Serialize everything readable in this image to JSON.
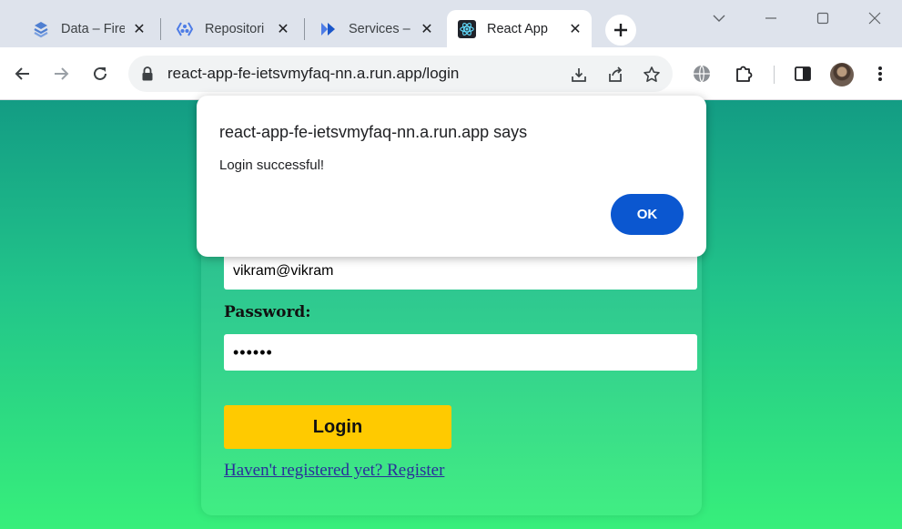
{
  "browser": {
    "tabs": [
      {
        "title": "Data – Fire",
        "icon": "firebase-icon",
        "active": false
      },
      {
        "title": "Repositori",
        "icon": "artifact-registry-icon",
        "active": false
      },
      {
        "title": "Services –",
        "icon": "cloud-run-icon",
        "active": false
      },
      {
        "title": "React App",
        "icon": "react-icon",
        "active": true
      }
    ],
    "url": "react-app-fe-ietsvmyfaq-nn.a.run.app/login",
    "colors": {
      "tabstrip": "#dee3ec",
      "toolbar": "#ffffff",
      "omnibox": "#f1f3f4"
    }
  },
  "page": {
    "email_value": "vikram@vikram",
    "password_label": "Password:",
    "password_value": "••••••",
    "login_button": "Login",
    "register_link": "Haven't registered yet? Register",
    "colors": {
      "gradient_top": "#139c84",
      "gradient_bottom": "#37ef7b",
      "button": "#ffca00",
      "link": "#2a2e9b"
    }
  },
  "dialog": {
    "origin": "react-app-fe-ietsvmyfaq-nn.a.run.app says",
    "message": "Login successful!",
    "ok_label": "OK",
    "colors": {
      "ok_button": "#0b57d0"
    }
  }
}
